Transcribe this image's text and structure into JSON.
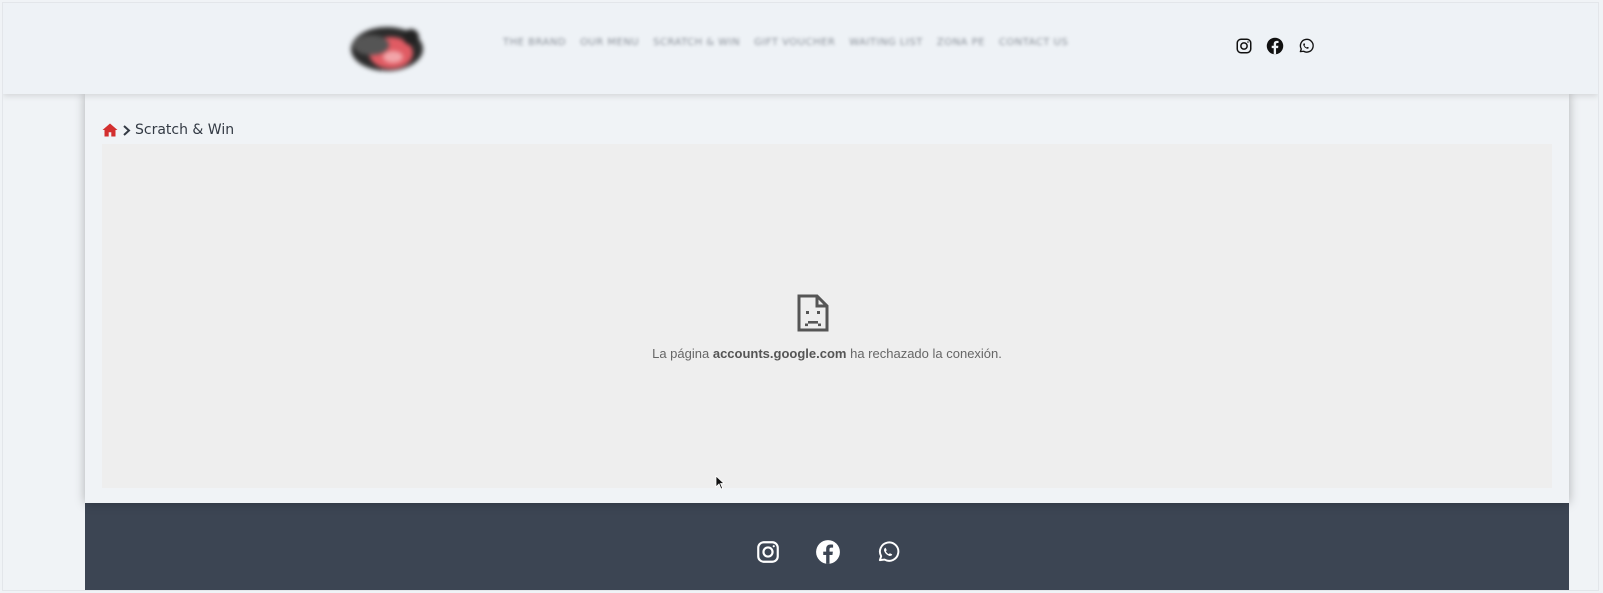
{
  "header": {
    "nav_items": [
      {
        "label": "THE BRAND"
      },
      {
        "label": "OUR MENU"
      },
      {
        "label": "SCRATCH & WIN"
      },
      {
        "label": "GIFT VOUCHER"
      },
      {
        "label": "WAITING LIST"
      },
      {
        "label": "ZONA PE"
      },
      {
        "label": "CONTACT US"
      }
    ],
    "social": [
      "instagram-icon",
      "facebook-icon",
      "whatsapp-icon"
    ]
  },
  "breadcrumb": {
    "current": "Scratch & Win"
  },
  "iframe_error": {
    "prefix": "La página",
    "host": "accounts.google.com",
    "suffix": "ha rechazado la conexión."
  },
  "footer": {
    "social": [
      "instagram-icon",
      "facebook-icon",
      "whatsapp-icon"
    ]
  },
  "colors": {
    "accent": "#d32f2f",
    "footer_bg": "#3c4553",
    "header_bg": "#eef2f6"
  }
}
